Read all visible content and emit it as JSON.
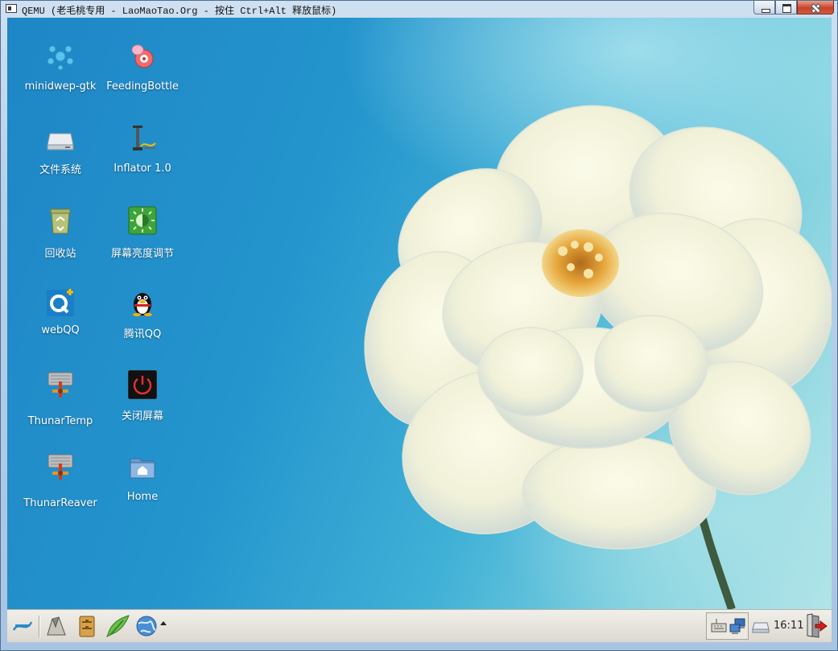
{
  "window": {
    "title": "QEMU (老毛桃专用 - LaoMaoTao.Org - 按住 Ctrl+Alt 释放鼠标)"
  },
  "desktop": {
    "icons": [
      {
        "label": "minidwep-gtk",
        "icon": "wifi-crack-icon"
      },
      {
        "label": "FeedingBottle",
        "icon": "feeding-bottle-icon"
      },
      {
        "label": "文件系统",
        "icon": "drive-icon"
      },
      {
        "label": "Inflator 1.0",
        "icon": "inflator-pump-icon"
      },
      {
        "label": "回收站",
        "icon": "recycle-bin-icon"
      },
      {
        "label": "屏幕亮度调节",
        "icon": "brightness-icon"
      },
      {
        "label": "webQQ",
        "icon": "webqq-icon"
      },
      {
        "label": "腾讯QQ",
        "icon": "qq-penguin-icon"
      },
      {
        "label": "ThunarTemp",
        "icon": "thunar-temp-icon"
      },
      {
        "label": "关闭屏幕",
        "icon": "power-icon"
      },
      {
        "label": "ThunarReaver",
        "icon": "thunar-reaver-icon"
      },
      {
        "label": "Home",
        "icon": "home-folder-icon"
      }
    ]
  },
  "taskbar": {
    "clock": "16:11",
    "launchers": [
      "menu-icon",
      "terminal-icon",
      "file-manager-icon",
      "editor-icon",
      "browser-icon"
    ]
  },
  "colors": {
    "desktop_blue": "#2495cd",
    "taskbar_bg": "#e6e3dc",
    "label_text": "#ffffff"
  }
}
